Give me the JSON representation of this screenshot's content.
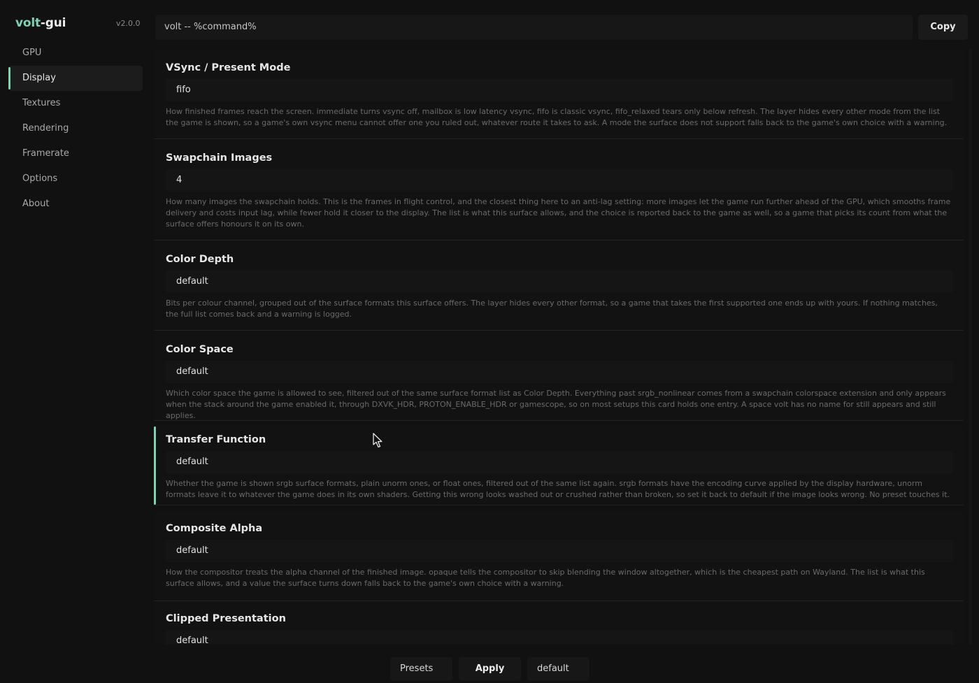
{
  "app": {
    "brand_accent": "volt",
    "brand_rest": "-gui",
    "version": "v2.0.0"
  },
  "sidebar": {
    "items": [
      {
        "label": "GPU"
      },
      {
        "label": "Display"
      },
      {
        "label": "Textures"
      },
      {
        "label": "Rendering"
      },
      {
        "label": "Framerate"
      },
      {
        "label": "Options"
      },
      {
        "label": "About"
      }
    ],
    "active": "Display"
  },
  "command": {
    "value": "volt -- %command%",
    "copy_label": "Copy"
  },
  "settings": [
    {
      "title": "VSync / Present Mode",
      "value": "fifo",
      "description": "How finished frames reach the screen. immediate turns vsync off, mailbox is low latency vsync, fifo is classic vsync, fifo_relaxed tears only below refresh. The layer hides every other mode from the list the game is shown, so a game's own vsync menu cannot offer one you ruled out, whatever route it takes to ask. A mode the surface does not support falls back to the game's own choice with a warning."
    },
    {
      "title": "Swapchain Images",
      "value": "4",
      "description": "How many images the swapchain holds. This is the frames in flight control, and the closest thing here to an anti-lag setting: more images let the game run further ahead of the GPU, which smooths frame delivery and costs input lag, while fewer hold it closer to the display. The list is what this surface allows, and the choice is reported back to the game as well, so a game that picks its count from what the surface offers honours it on its own."
    },
    {
      "title": "Color Depth",
      "value": "default",
      "description": "Bits per colour channel, grouped out of the surface formats this surface offers. The layer hides every other format, so a game that takes the first supported one ends up with yours. If nothing matches, the full list comes back and a warning is logged."
    },
    {
      "title": "Color Space",
      "value": "default",
      "description": "Which color space the game is allowed to see, filtered out of the same surface format list as Color Depth. Everything past srgb_nonlinear comes from a swapchain colorspace extension and only appears when the stack around the game enabled it, through DXVK_HDR, PROTON_ENABLE_HDR or gamescope, so on most setups this card holds one entry. A space volt has no name for still appears and still applies."
    },
    {
      "title": "Transfer Function",
      "value": "default",
      "description": "Whether the game is shown srgb surface formats, plain unorm ones, or float ones, filtered out of the same list again. srgb formats have the encoding curve applied by the display hardware, unorm formats leave it to whatever the game does in its own shaders. Getting this wrong looks washed out or crushed rather than broken, so set it back to default if the image looks wrong. No preset touches it."
    },
    {
      "title": "Composite Alpha",
      "value": "default",
      "description": "How the compositor treats the alpha channel of the finished image. opaque tells the compositor to skip blending the window altogether, which is the cheapest path on Wayland. The list is what this surface allows, and a value the surface turns down falls back to the game's own choice with a warning."
    },
    {
      "title": "Clipped Presentation",
      "value": "default",
      "description": ""
    }
  ],
  "footer": {
    "presets_label": "Presets",
    "apply_label": "Apply",
    "profile_value": "default"
  },
  "colors": {
    "accent": "#7dd3b0",
    "background": "#111111",
    "card": "#121212",
    "field": "#151515"
  }
}
